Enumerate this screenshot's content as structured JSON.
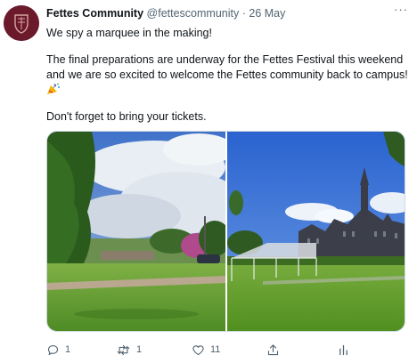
{
  "tweet": {
    "author": {
      "display_name": "Fettes Community",
      "handle": "@fettescommunity",
      "separator": "·",
      "date": "26 May"
    },
    "more_icon": "more-horizontal-icon",
    "text": {
      "line1": "We spy a marquee in the making!",
      "line2": "The final preparations are underway for the Fettes Festival this weekend",
      "line3": "and we are so excited to welcome the Fettes community back to campus!",
      "emoji": "party-popper-emoji",
      "line4": "Don't forget to bring your tickets."
    },
    "media": {
      "images": [
        "campus-lawn-photo",
        "marquee-school-photo"
      ]
    },
    "actions": {
      "reply": {
        "icon": "reply-icon",
        "count": "1"
      },
      "retweet": {
        "icon": "retweet-icon",
        "count": "1"
      },
      "like": {
        "icon": "heart-icon",
        "count": "11"
      },
      "share": {
        "icon": "share-icon"
      },
      "stats": {
        "icon": "analytics-icon"
      }
    },
    "colors": {
      "text": "#0f1419",
      "muted": "#536471",
      "avatar": "#6b1a2b"
    }
  }
}
